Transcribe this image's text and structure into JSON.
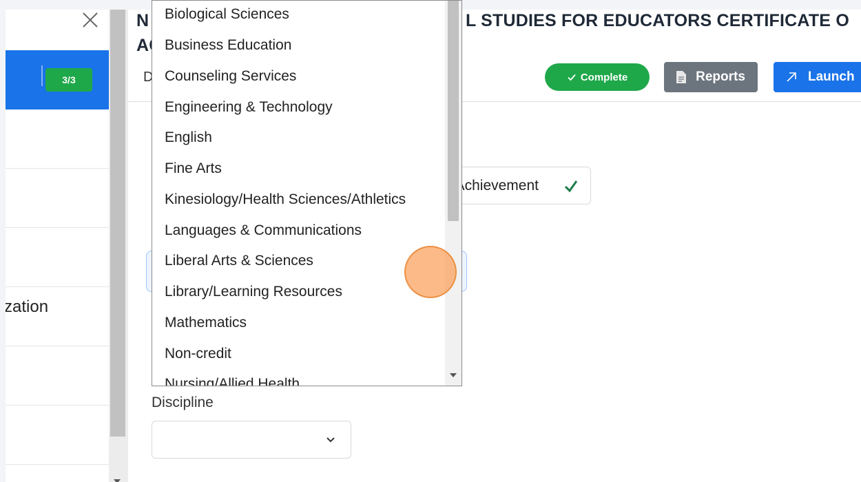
{
  "left_panel": {
    "progress_badge": "3/3",
    "partial_label": "zation"
  },
  "header": {
    "title_line1": "N",
    "title_line1_right": "L STUDIES FOR EDUCATORS CERTIFICATE O",
    "title_line2": "AC",
    "tab_partial": "D",
    "complete_label": "Complete",
    "reports_label": "Reports",
    "launch_label": "Launch"
  },
  "form": {
    "achievement_text": "Achievement",
    "discipline_label": "Discipline",
    "discipline_value": ""
  },
  "dropdown": {
    "items": [
      "Biological Sciences",
      "Business Education",
      "Counseling Services",
      "Engineering & Technology",
      "English",
      "Fine Arts",
      "Kinesiology/Health Sciences/Athletics",
      "Languages & Communications",
      "Liberal Arts & Sciences",
      "Library/Learning Resources",
      "Mathematics",
      "Non-credit",
      "Nursing/Allied Health"
    ]
  },
  "colors": {
    "primary": "#1a73e8",
    "success": "#1fa84a",
    "secondary": "#6c757d",
    "click_marker": "#f6a05a"
  },
  "icons": {
    "close": "close-icon",
    "complete": "check-icon",
    "reports": "document-icon",
    "launch": "external-arrow-icon",
    "achievement": "check-icon",
    "discipline": "chevron-down-icon"
  }
}
